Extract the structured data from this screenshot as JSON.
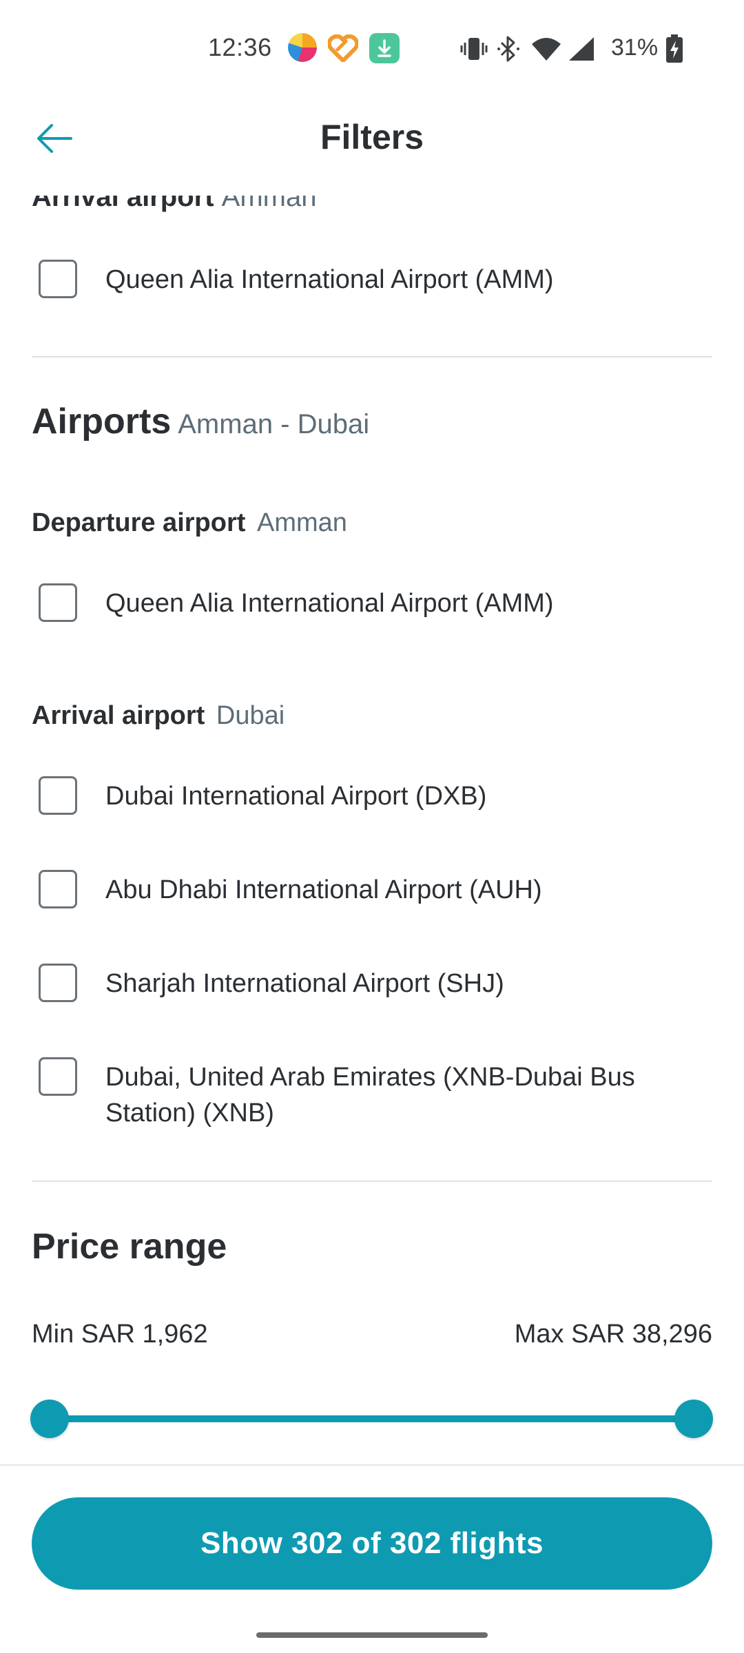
{
  "status_bar": {
    "time": "12:36",
    "battery": "31%",
    "icons": [
      "app-icon-colorful",
      "app-icon-orange-heart",
      "download-icon",
      "vibrate-icon",
      "bluetooth-icon",
      "wifi-icon",
      "signal-icon",
      "battery-charging-icon"
    ]
  },
  "header": {
    "title": "Filters",
    "back_icon": "arrow-left-icon"
  },
  "arrival_section_top": {
    "label": "Arrival airport",
    "city": "Amman",
    "options": [
      {
        "label": "Queen Alia International Airport (AMM)",
        "checked": false
      }
    ]
  },
  "airports": {
    "title": "Airports",
    "route": "Amman - Dubai",
    "departure": {
      "label": "Departure airport",
      "city": "Amman",
      "options": [
        {
          "label": "Queen Alia International Airport (AMM)",
          "checked": false
        }
      ]
    },
    "arrival": {
      "label": "Arrival airport",
      "city": "Dubai",
      "options": [
        {
          "label": "Dubai International Airport (DXB)",
          "checked": false
        },
        {
          "label": "Abu Dhabi International Airport (AUH)",
          "checked": false
        },
        {
          "label": "Sharjah International Airport (SHJ)",
          "checked": false
        },
        {
          "label": "Dubai, United Arab Emirates (XNB-Dubai Bus Station) (XNB)",
          "checked": false
        }
      ]
    }
  },
  "price_range": {
    "title": "Price range",
    "min_label": "Min SAR 1,962",
    "max_label": "Max SAR 38,296",
    "selected_min": 1962,
    "selected_max": 38296
  },
  "footer": {
    "cta_label": "Show 302 of 302 flights"
  },
  "colors": {
    "accent": "#0e9bb2",
    "text": "#2b2f33",
    "muted": "#5d6d78"
  }
}
